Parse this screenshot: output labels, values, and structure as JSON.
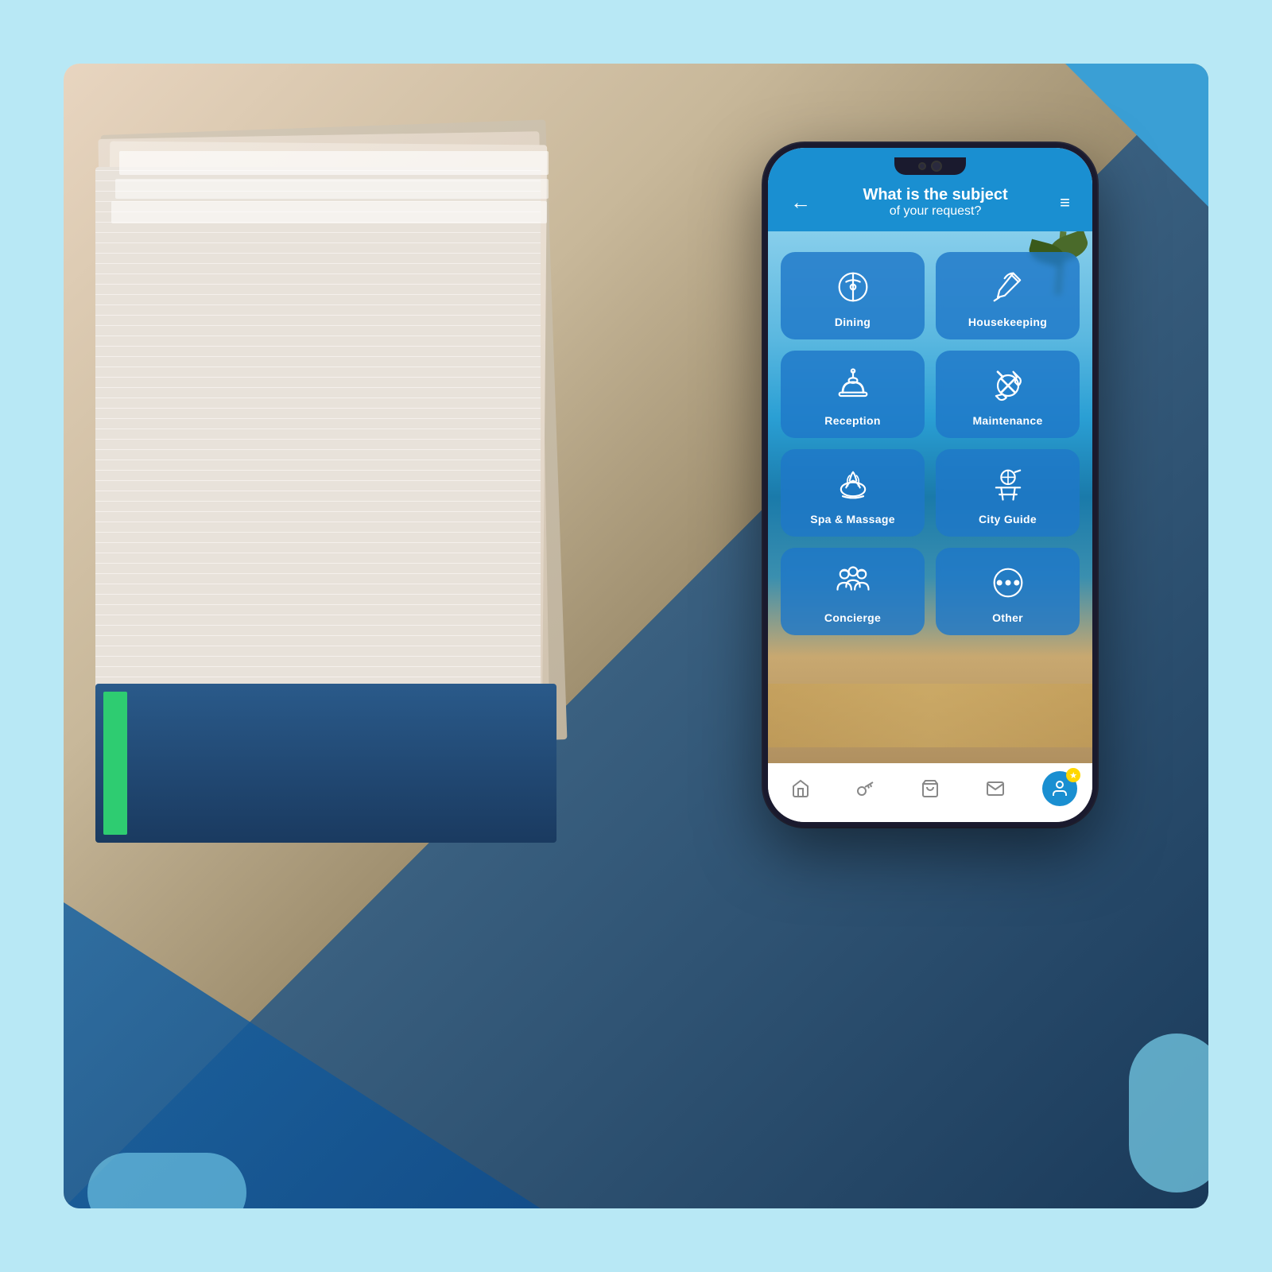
{
  "page": {
    "background_color": "#b8e8f5"
  },
  "phone": {
    "header": {
      "back_label": "←",
      "title_line1": "What is the subject",
      "title_line2": "of your request?",
      "menu_label": "≡"
    },
    "services": [
      {
        "id": "dining",
        "label": "Dining",
        "icon": "dining"
      },
      {
        "id": "housekeeping",
        "label": "Housekeeping",
        "icon": "housekeeping"
      },
      {
        "id": "reception",
        "label": "Reception",
        "icon": "reception"
      },
      {
        "id": "maintenance",
        "label": "Maintenance",
        "icon": "maintenance"
      },
      {
        "id": "spa",
        "label": "Spa & Massage",
        "icon": "spa"
      },
      {
        "id": "cityguide",
        "label": "City Guide",
        "icon": "cityguide"
      },
      {
        "id": "concierge",
        "label": "Concierge",
        "icon": "concierge"
      },
      {
        "id": "other",
        "label": "Other",
        "icon": "other"
      }
    ],
    "tabbar": [
      {
        "id": "home",
        "icon": "🏠"
      },
      {
        "id": "key",
        "icon": "🗝"
      },
      {
        "id": "bag",
        "icon": "🛒"
      },
      {
        "id": "mail",
        "icon": "✉"
      },
      {
        "id": "profile",
        "icon": "👤"
      }
    ]
  }
}
